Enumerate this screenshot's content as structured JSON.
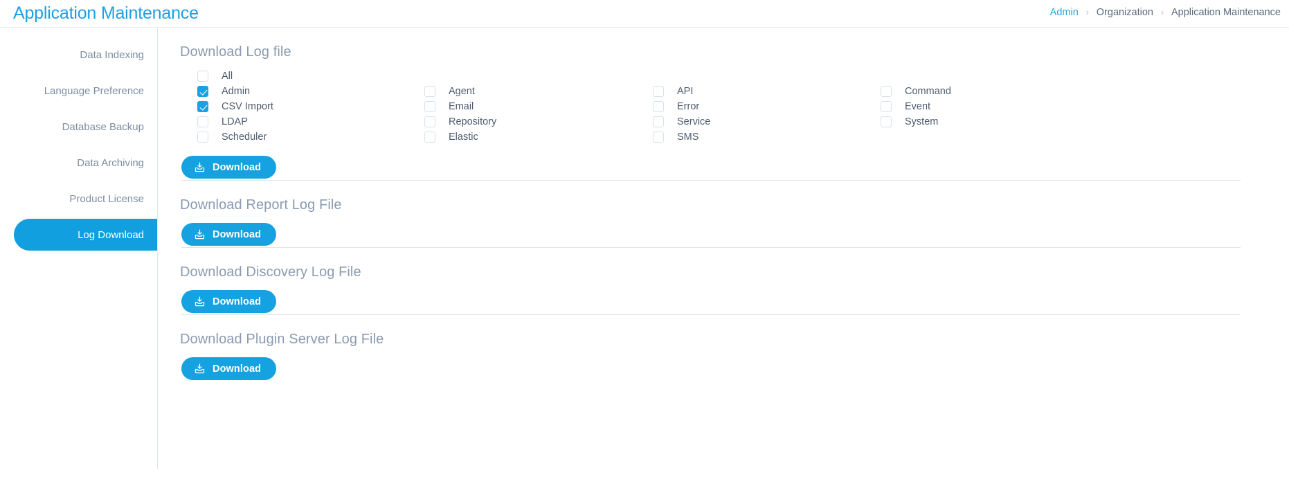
{
  "header": {
    "app_title": "Application Maintenance",
    "breadcrumb": [
      {
        "label": "Admin",
        "type": "link"
      },
      {
        "label": "Organization",
        "type": "text"
      },
      {
        "label": "Application Maintenance",
        "type": "text"
      }
    ],
    "separator": "›"
  },
  "sidebar": {
    "items": [
      {
        "label": "Data Indexing",
        "active": false
      },
      {
        "label": "Language Preference",
        "active": false
      },
      {
        "label": "Database Backup",
        "active": false
      },
      {
        "label": "Data Archiving",
        "active": false
      },
      {
        "label": "Product License",
        "active": false
      },
      {
        "label": "Log Download",
        "active": true
      }
    ]
  },
  "main": {
    "sections": [
      {
        "id": "log-file",
        "title": "Download Log file",
        "button_label": "Download",
        "button_icon": "download-tray-icon"
      },
      {
        "id": "report-log",
        "title": "Download Report Log File",
        "button_label": "Download",
        "button_icon": "download-tray-icon"
      },
      {
        "id": "discovery-log",
        "title": "Download Discovery Log File",
        "button_label": "Download",
        "button_icon": "download-tray-icon"
      },
      {
        "id": "plugin-server-log",
        "title": "Download Plugin Server Log File",
        "button_label": "Download",
        "button_icon": "download-tray-icon"
      }
    ],
    "log_checkbox_columns": [
      {
        "id": "col-1",
        "items": [
          {
            "label": "All",
            "checked": false
          },
          {
            "label": "Admin",
            "checked": true
          },
          {
            "label": "CSV Import",
            "checked": true
          },
          {
            "label": "LDAP",
            "checked": false
          },
          {
            "label": "Scheduler",
            "checked": false
          }
        ]
      },
      {
        "id": "col-2",
        "items": [
          {
            "label": "Agent",
            "checked": false
          },
          {
            "label": "Email",
            "checked": false
          },
          {
            "label": "Repository",
            "checked": false
          },
          {
            "label": "Elastic",
            "checked": false
          }
        ]
      },
      {
        "id": "col-3",
        "items": [
          {
            "label": "API",
            "checked": false
          },
          {
            "label": "Error",
            "checked": false
          },
          {
            "label": "Service",
            "checked": false
          },
          {
            "label": "SMS",
            "checked": false
          }
        ]
      },
      {
        "id": "col-4",
        "items": [
          {
            "label": "Command",
            "checked": false
          },
          {
            "label": "Event",
            "checked": false
          },
          {
            "label": "System",
            "checked": false
          }
        ]
      }
    ]
  },
  "colors": {
    "accent": "#1ba1e2",
    "button": "#16a2e0",
    "title_text": "#8b9bb0",
    "sidebar_text": "#7c8da3",
    "label_text": "#4d5b6e",
    "border": "#dfe6ee"
  }
}
